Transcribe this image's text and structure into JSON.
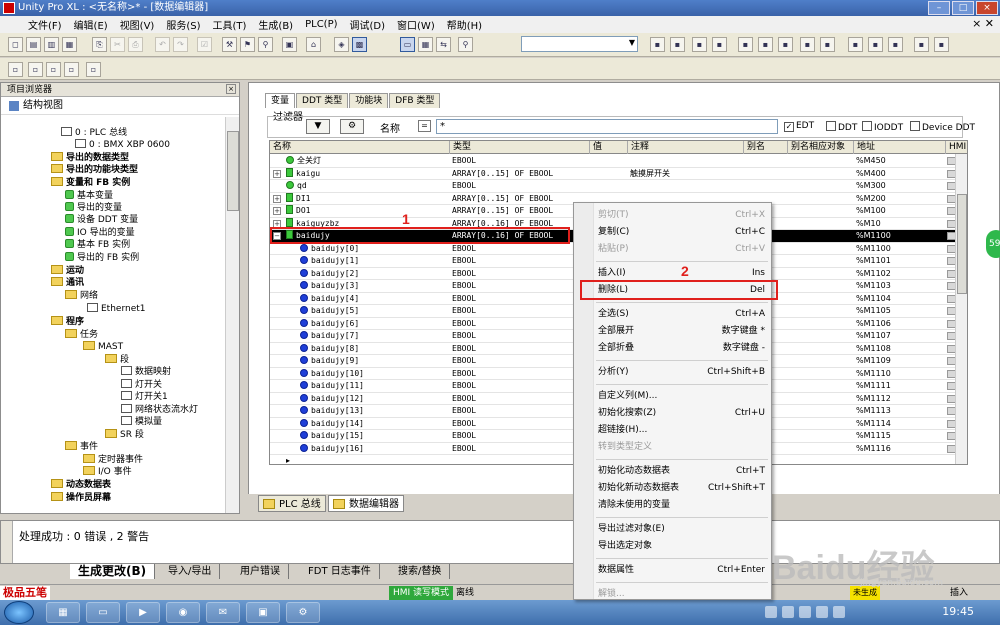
{
  "window": {
    "title": "Unity Pro XL : <无名称>* - [数据编辑器]"
  },
  "menu": [
    "文件(F)",
    "编辑(E)",
    "视图(V)",
    "服务(S)",
    "工具(T)",
    "生成(B)",
    "PLC(P)",
    "调试(D)",
    "窗口(W)",
    "帮助(H)"
  ],
  "project_browser": {
    "title": "项目浏览器",
    "structure_view": "结构视图",
    "tree": [
      {
        "label": "0 : PLC 总线",
        "indent": 60,
        "icon": "d",
        "bold": false
      },
      {
        "label": "0 : BMX XBP 0600",
        "indent": 74,
        "icon": "d",
        "bold": false
      },
      {
        "label": "导出的数据类型",
        "indent": 50,
        "icon": "f",
        "bold": true
      },
      {
        "label": "导出的功能块类型",
        "indent": 50,
        "icon": "f",
        "bold": true
      },
      {
        "label": "变量和 FB 实例",
        "indent": 50,
        "icon": "f",
        "bold": true
      },
      {
        "label": "基本变量",
        "indent": 64,
        "icon": "g",
        "bold": false
      },
      {
        "label": "导出的变量",
        "indent": 64,
        "icon": "g",
        "bold": false
      },
      {
        "label": "设备 DDT 变量",
        "indent": 64,
        "icon": "g",
        "bold": false
      },
      {
        "label": "IO 导出的变量",
        "indent": 64,
        "icon": "g",
        "bold": false
      },
      {
        "label": "基本 FB 实例",
        "indent": 64,
        "icon": "g",
        "bold": false
      },
      {
        "label": "导出的 FB 实例",
        "indent": 64,
        "icon": "g",
        "bold": false
      },
      {
        "label": "运动",
        "indent": 50,
        "icon": "f",
        "bold": true
      },
      {
        "label": "通讯",
        "indent": 50,
        "icon": "f",
        "bold": true
      },
      {
        "label": "网络",
        "indent": 64,
        "icon": "f",
        "bold": false
      },
      {
        "label": "Ethernet1",
        "indent": 86,
        "icon": "d",
        "bold": false
      },
      {
        "label": "程序",
        "indent": 50,
        "icon": "f",
        "bold": true
      },
      {
        "label": "任务",
        "indent": 64,
        "icon": "f",
        "bold": false
      },
      {
        "label": "MAST",
        "indent": 82,
        "icon": "f",
        "bold": false
      },
      {
        "label": "段",
        "indent": 104,
        "icon": "f",
        "bold": false
      },
      {
        "label": "数据映射",
        "indent": 120,
        "icon": "d",
        "bold": false
      },
      {
        "label": "灯开关",
        "indent": 120,
        "icon": "d",
        "bold": false
      },
      {
        "label": "灯开关1",
        "indent": 120,
        "icon": "d",
        "bold": false
      },
      {
        "label": "网络状态流水灯",
        "indent": 120,
        "icon": "d",
        "bold": false
      },
      {
        "label": "模拟量",
        "indent": 120,
        "icon": "d",
        "bold": false
      },
      {
        "label": "SR 段",
        "indent": 104,
        "icon": "f",
        "bold": false
      },
      {
        "label": "事件",
        "indent": 64,
        "icon": "f",
        "bold": false
      },
      {
        "label": "定时器事件",
        "indent": 82,
        "icon": "f",
        "bold": false
      },
      {
        "label": "I/O 事件",
        "indent": 82,
        "icon": "f",
        "bold": false
      },
      {
        "label": "动态数据表",
        "indent": 50,
        "icon": "f",
        "bold": true
      },
      {
        "label": "操作员屏幕",
        "indent": 50,
        "icon": "f",
        "bold": true
      }
    ]
  },
  "editor": {
    "tabs": [
      "变量",
      "DDT 类型",
      "功能块",
      "DFB 类型"
    ],
    "filter_label": "过滤器",
    "filter_name_label": "名称",
    "filter_name_btn": "=",
    "filter_value": "*",
    "checkboxes": [
      {
        "label": "EDT",
        "checked": true
      },
      {
        "label": "DDT",
        "checked": false
      },
      {
        "label": "IODDT",
        "checked": false
      },
      {
        "label": "Device DDT",
        "checked": false
      }
    ],
    "columns": [
      "名称",
      "类型",
      "值",
      "注释",
      "别名",
      "别名相应对象",
      "地址",
      "HMI"
    ],
    "rows": [
      {
        "name": "全关灯",
        "type": "EBOOL",
        "comment": "",
        "address": "%M450",
        "icon": "dot-green",
        "expand": false,
        "child": false,
        "selected": false
      },
      {
        "name": "kaigu",
        "type": "ARRAY[0..15] OF EBOOL",
        "comment": "触摸屏开关",
        "address": "%M400",
        "icon": "rect",
        "expand": true,
        "child": false,
        "selected": false
      },
      {
        "name": "qd",
        "type": "EBOOL",
        "comment": "",
        "address": "%M300",
        "icon": "dot-green",
        "expand": false,
        "child": false,
        "selected": false
      },
      {
        "name": "DI1",
        "type": "ARRAY[0..15] OF EBOOL",
        "comment": "",
        "address": "%M200",
        "icon": "rect",
        "expand": true,
        "child": false,
        "selected": false
      },
      {
        "name": "DO1",
        "type": "ARRAY[0..15] OF EBOOL",
        "comment": "",
        "address": "%M100",
        "icon": "rect",
        "expand": true,
        "child": false,
        "selected": false
      },
      {
        "name": "kaiguyzbz",
        "type": "ARRAY[0..16] OF EBOOL",
        "comment": "",
        "address": "%M10",
        "icon": "rect",
        "expand": true,
        "child": false,
        "selected": false
      },
      {
        "name": "baidujy",
        "type": "ARRAY[0..16] OF EBOOL",
        "comment": "",
        "address": "%M1100",
        "icon": "rect",
        "expand": true,
        "child": false,
        "selected": true
      },
      {
        "name": "baidujy[0]",
        "type": "EBOOL",
        "comment": "",
        "address": "%M1100",
        "icon": "dot-blue",
        "expand": false,
        "child": true,
        "selected": false
      },
      {
        "name": "baidujy[1]",
        "type": "EBOOL",
        "comment": "",
        "address": "%M1101",
        "icon": "dot-blue",
        "expand": false,
        "child": true,
        "selected": false
      },
      {
        "name": "baidujy[2]",
        "type": "EBOOL",
        "comment": "",
        "address": "%M1102",
        "icon": "dot-blue",
        "expand": false,
        "child": true,
        "selected": false
      },
      {
        "name": "baidujy[3]",
        "type": "EBOOL",
        "comment": "",
        "address": "%M1103",
        "icon": "dot-blue",
        "expand": false,
        "child": true,
        "selected": false
      },
      {
        "name": "baidujy[4]",
        "type": "EBOOL",
        "comment": "",
        "address": "%M1104",
        "icon": "dot-blue",
        "expand": false,
        "child": true,
        "selected": false
      },
      {
        "name": "baidujy[5]",
        "type": "EBOOL",
        "comment": "",
        "address": "%M1105",
        "icon": "dot-blue",
        "expand": false,
        "child": true,
        "selected": false
      },
      {
        "name": "baidujy[6]",
        "type": "EBOOL",
        "comment": "",
        "address": "%M1106",
        "icon": "dot-blue",
        "expand": false,
        "child": true,
        "selected": false
      },
      {
        "name": "baidujy[7]",
        "type": "EBOOL",
        "comment": "",
        "address": "%M1107",
        "icon": "dot-blue",
        "expand": false,
        "child": true,
        "selected": false
      },
      {
        "name": "baidujy[8]",
        "type": "EBOOL",
        "comment": "",
        "address": "%M1108",
        "icon": "dot-blue",
        "expand": false,
        "child": true,
        "selected": false
      },
      {
        "name": "baidujy[9]",
        "type": "EBOOL",
        "comment": "",
        "address": "%M1109",
        "icon": "dot-blue",
        "expand": false,
        "child": true,
        "selected": false
      },
      {
        "name": "baidujy[10]",
        "type": "EBOOL",
        "comment": "",
        "address": "%M1110",
        "icon": "dot-blue",
        "expand": false,
        "child": true,
        "selected": false
      },
      {
        "name": "baidujy[11]",
        "type": "EBOOL",
        "comment": "",
        "address": "%M1111",
        "icon": "dot-blue",
        "expand": false,
        "child": true,
        "selected": false
      },
      {
        "name": "baidujy[12]",
        "type": "EBOOL",
        "comment": "",
        "address": "%M1112",
        "icon": "dot-blue",
        "expand": false,
        "child": true,
        "selected": false
      },
      {
        "name": "baidujy[13]",
        "type": "EBOOL",
        "comment": "",
        "address": "%M1113",
        "icon": "dot-blue",
        "expand": false,
        "child": true,
        "selected": false
      },
      {
        "name": "baidujy[14]",
        "type": "EBOOL",
        "comment": "",
        "address": "%M1114",
        "icon": "dot-blue",
        "expand": false,
        "child": true,
        "selected": false
      },
      {
        "name": "baidujy[15]",
        "type": "EBOOL",
        "comment": "",
        "address": "%M1115",
        "icon": "dot-blue",
        "expand": false,
        "child": true,
        "selected": false
      },
      {
        "name": "baidujy[16]",
        "type": "EBOOL",
        "comment": "",
        "address": "%M1116",
        "icon": "dot-blue",
        "expand": false,
        "child": true,
        "selected": false
      }
    ]
  },
  "doc_tabs": [
    "PLC 总线",
    "数据编辑器"
  ],
  "output": {
    "message": "处理成功 : 0 错误 , 2 警告",
    "tabs": [
      "生成更改(B)",
      "导入/导出",
      "用户错误",
      "FDT 日志事件",
      "搜索/替换"
    ]
  },
  "context_menu": {
    "items": [
      {
        "label": "剪切(T)",
        "shortcut": "Ctrl+X",
        "disabled": true
      },
      {
        "label": "复制(C)",
        "shortcut": "Ctrl+C",
        "disabled": false
      },
      {
        "label": "粘贴(P)",
        "shortcut": "Ctrl+V",
        "disabled": true
      },
      {
        "sep": true
      },
      {
        "label": "插入(I)",
        "shortcut": "Ins",
        "disabled": false
      },
      {
        "label": "删除(L)",
        "shortcut": "Del",
        "disabled": false
      },
      {
        "sep": true
      },
      {
        "label": "全选(S)",
        "shortcut": "Ctrl+A",
        "disabled": false
      },
      {
        "label": "全部展开",
        "shortcut": "数字键盘 *",
        "disabled": false
      },
      {
        "label": "全部折叠",
        "shortcut": "数字键盘 -",
        "disabled": false
      },
      {
        "sep": true
      },
      {
        "label": "分析(Y)",
        "shortcut": "Ctrl+Shift+B",
        "disabled": false
      },
      {
        "sep": true
      },
      {
        "label": "自定义列(M)...",
        "shortcut": "",
        "disabled": false
      },
      {
        "label": "初始化搜索(Z)",
        "shortcut": "Ctrl+U",
        "disabled": false
      },
      {
        "label": "超链接(H)...",
        "shortcut": "",
        "disabled": false
      },
      {
        "label": "转到类型定义",
        "shortcut": "",
        "disabled": true
      },
      {
        "sep": true
      },
      {
        "label": "初始化动态数据表",
        "shortcut": "Ctrl+T",
        "disabled": false
      },
      {
        "label": "初始化新动态数据表",
        "shortcut": "Ctrl+Shift+T",
        "disabled": false
      },
      {
        "label": "清除未使用的变量",
        "shortcut": "",
        "disabled": false
      },
      {
        "sep": true
      },
      {
        "label": "导出过滤对象(E)",
        "shortcut": "",
        "disabled": false
      },
      {
        "label": "导出选定对象",
        "shortcut": "",
        "disabled": false
      },
      {
        "sep": true
      },
      {
        "label": "数据属性",
        "shortcut": "Ctrl+Enter",
        "disabled": false
      },
      {
        "sep": true
      },
      {
        "label": "解锁...",
        "shortcut": "",
        "disabled": true
      }
    ]
  },
  "annotations": {
    "marker1": "1",
    "marker2": "2"
  },
  "status": {
    "ime": "极品五笔",
    "hmi": "HMI 读写模式",
    "offline": "离线",
    "unbuilt": "未生成",
    "insert": "插入"
  },
  "taskbar": {
    "clock": "19:45"
  },
  "watermark": {
    "main": "Baidu经验",
    "sub": "jingyan.baidu.com"
  },
  "side_badge": "59",
  "colors": {
    "highlight": "#e0201c",
    "selected_row": "#000000",
    "hmi_green": "#2fa83c"
  }
}
